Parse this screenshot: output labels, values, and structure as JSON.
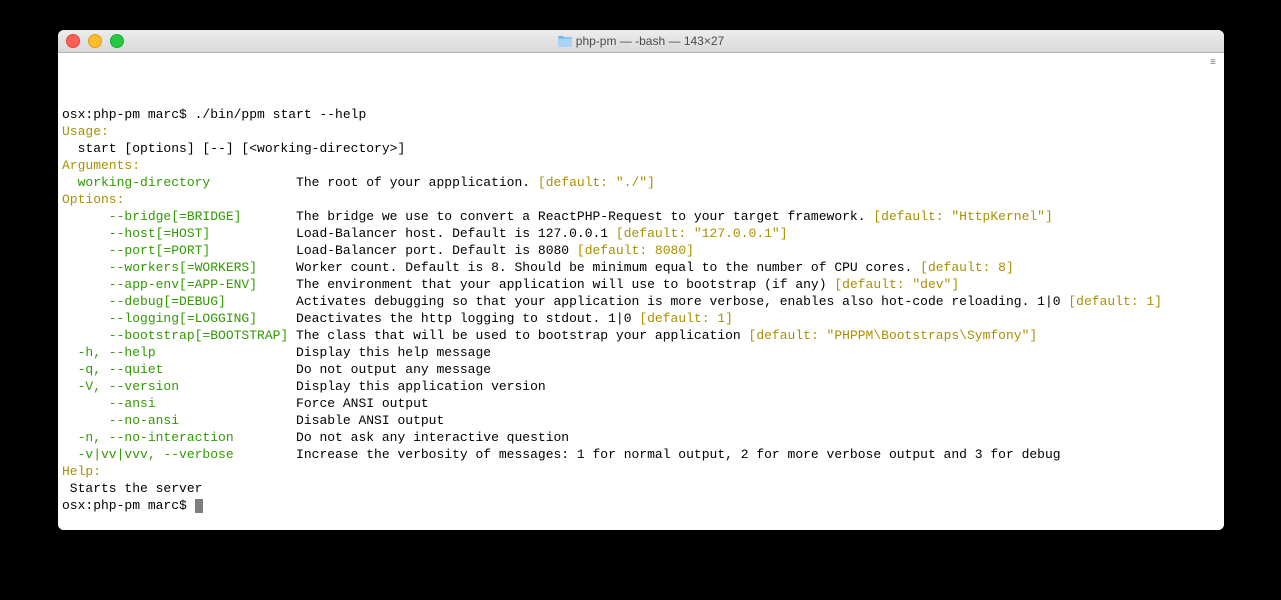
{
  "window": {
    "title": "php-pm — -bash — 143×27"
  },
  "prompt1": "osx:php-pm marc$ ",
  "cmd1": "./bin/ppm start --help",
  "usage_hdr": "Usage:",
  "usage_line": "  start [options] [--] [<working-directory>]",
  "args_hdr": "Arguments:",
  "arg_name": "  working-directory",
  "arg_desc": "The root of your appplication. ",
  "arg_def": "[default: \"./\"]",
  "opts_hdr": "Options:",
  "opts": [
    {
      "flag": "      --bridge[=BRIDGE]",
      "desc": "The bridge we use to convert a ReactPHP-Request to your target framework. ",
      "def": "[default: \"HttpKernel\"]"
    },
    {
      "flag": "      --host[=HOST]",
      "desc": "Load-Balancer host. Default is 127.0.0.1 ",
      "def": "[default: \"127.0.0.1\"]"
    },
    {
      "flag": "      --port[=PORT]",
      "desc": "Load-Balancer port. Default is 8080 ",
      "def": "[default: 8080]"
    },
    {
      "flag": "      --workers[=WORKERS]",
      "desc": "Worker count. Default is 8. Should be minimum equal to the number of CPU cores. ",
      "def": "[default: 8]"
    },
    {
      "flag": "      --app-env[=APP-ENV]",
      "desc": "The environment that your application will use to bootstrap (if any) ",
      "def": "[default: \"dev\"]"
    },
    {
      "flag": "      --debug[=DEBUG]",
      "desc": "Activates debugging so that your application is more verbose, enables also hot-code reloading. 1|0 ",
      "def": "[default: 1]"
    },
    {
      "flag": "      --logging[=LOGGING]",
      "desc": "Deactivates the http logging to stdout. 1|0 ",
      "def": "[default: 1]"
    },
    {
      "flag": "      --bootstrap[=BOOTSTRAP]",
      "desc": "The class that will be used to bootstrap your application ",
      "def": "[default: \"PHPPM\\Bootstraps\\Symfony\"]"
    },
    {
      "flag": "  -h, --help",
      "desc": "Display this help message",
      "def": ""
    },
    {
      "flag": "  -q, --quiet",
      "desc": "Do not output any message",
      "def": ""
    },
    {
      "flag": "  -V, --version",
      "desc": "Display this application version",
      "def": ""
    },
    {
      "flag": "      --ansi",
      "desc": "Force ANSI output",
      "def": ""
    },
    {
      "flag": "      --no-ansi",
      "desc": "Disable ANSI output",
      "def": ""
    },
    {
      "flag": "  -n, --no-interaction",
      "desc": "Do not ask any interactive question",
      "def": ""
    },
    {
      "flag": "  -v|vv|vvv, --verbose",
      "desc": "Increase the verbosity of messages: 1 for normal output, 2 for more verbose output and 3 for debug",
      "def": ""
    }
  ],
  "help_hdr": "Help:",
  "help_text": " Starts the server",
  "prompt2": "osx:php-pm marc$ ",
  "opt_col_width": 30
}
